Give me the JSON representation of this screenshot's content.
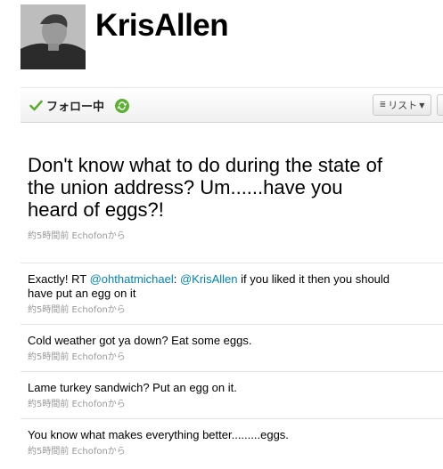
{
  "profile": {
    "username": "KrisAllen"
  },
  "actions": {
    "follow_label": "フォロー中",
    "list_label": "リスト"
  },
  "featured_tweet": {
    "text": "Don't know what to do during the state of the union address? Um......have you heard of eggs?!",
    "meta": "約5時間前 Echofonから"
  },
  "tweets": [
    {
      "prefix": "Exactly! RT ",
      "mention1": "@ohthatmichael",
      "mid": ": ",
      "mention2": "@KrisAllen",
      "suffix": " if you liked it then you should have put an egg on it",
      "meta": "約5時間前 Echofonから"
    },
    {
      "text": "Cold weather got ya down? Eat some eggs.",
      "meta": "約5時間前 Echofonから"
    },
    {
      "text": "Lame turkey sandwich? Put an egg on it.",
      "meta": "約5時間前 Echofonから"
    },
    {
      "text": "You know what makes everything better.........eggs.",
      "meta": "約5時間前 Echofonから"
    }
  ],
  "colors": {
    "mention": "#0084b4",
    "follow_check": "#5bb02f",
    "meta": "#999999"
  },
  "icons": {
    "check": "check-icon",
    "retweet": "retweet-icon",
    "list": "list-lines-icon",
    "caret": "caret-down-icon"
  }
}
